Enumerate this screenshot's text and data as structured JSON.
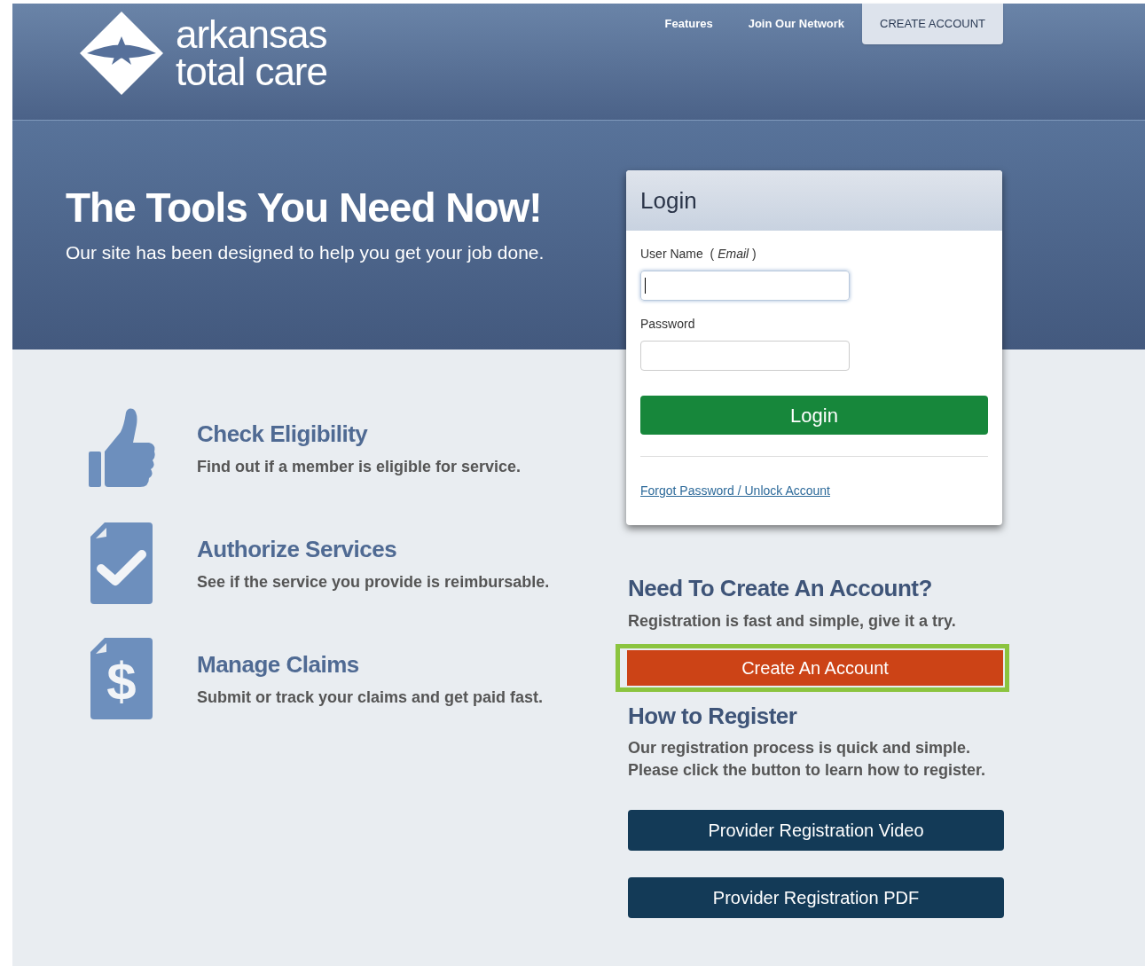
{
  "header": {
    "logo": {
      "line1": "arkansas",
      "line2": "total care"
    },
    "nav": [
      {
        "label": "Features",
        "selected": false
      },
      {
        "label": "Join Our Network",
        "selected": false
      },
      {
        "label": "CREATE ACCOUNT",
        "selected": true
      }
    ]
  },
  "hero": {
    "title": "The Tools You Need Now!",
    "subtitle": "Our site has been designed to help you get your job done."
  },
  "features": [
    {
      "kind": "thumb",
      "title": "Check Eligibility",
      "text": "Find out if a member is eligible for service."
    },
    {
      "kind": "check",
      "title": "Authorize Services",
      "text": "See if the service you provide is reimbursable."
    },
    {
      "kind": "dollar",
      "symbol": "$",
      "title": "Manage Claims",
      "text": "Submit or track your claims and get paid fast."
    }
  ],
  "login": {
    "title": "Login",
    "username_label": "User Name  ( *Email* )",
    "username_focused": true,
    "password_label": "Password",
    "button": "Login",
    "forgot_link": "Forgot Password / Unlock Account"
  },
  "create_account": {
    "title": "Need To Create An Account?",
    "text": "Registration is fast and simple, give it a try.",
    "button": "Create An Account",
    "highlighted": true
  },
  "register": {
    "title": "How to Register",
    "text": "Our registration process is quick and simple. Please click the button to learn how to register.",
    "buttons": [
      "Provider Registration Video",
      "Provider Registration PDF"
    ]
  }
}
